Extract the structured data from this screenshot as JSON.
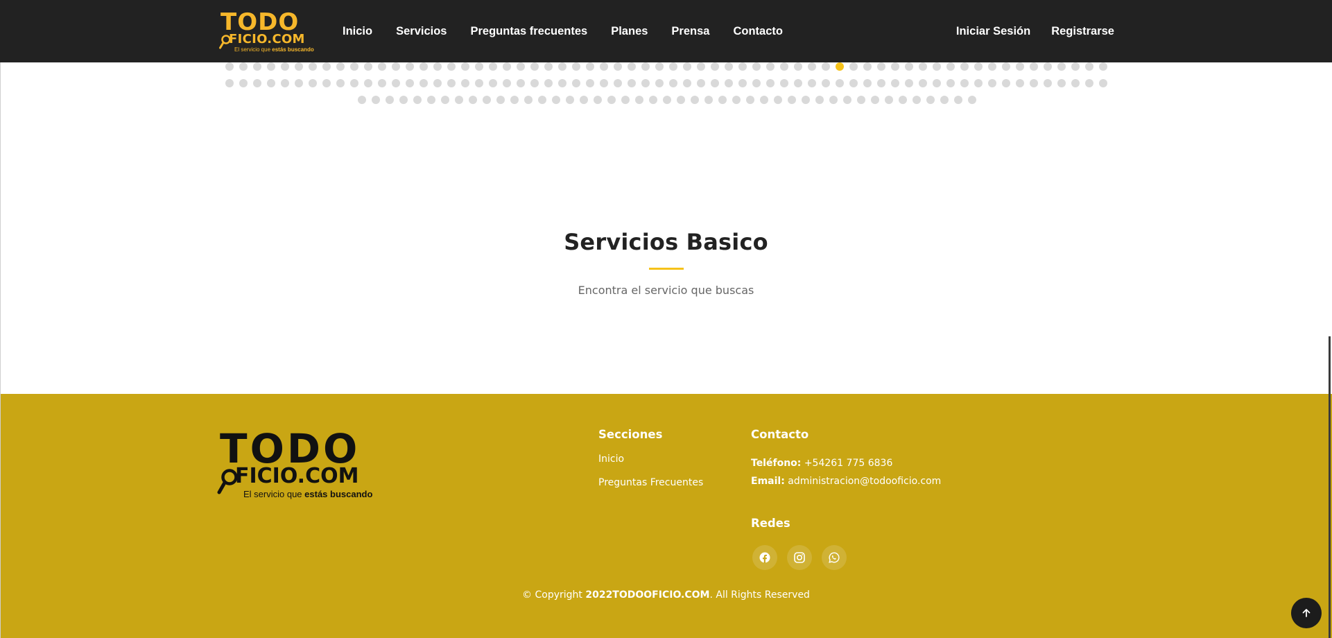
{
  "header": {
    "logo": {
      "top": "TODO",
      "bottom": "FICIO.COM",
      "tagline_pre": "El servicio que ",
      "tagline_bold": "estás buscando"
    },
    "nav": [
      "Inicio",
      "Servicios",
      "Preguntas frecuentes",
      "Planes",
      "Prensa",
      "Contacto"
    ],
    "login": "Iniciar Sesión",
    "register": "Registrarse"
  },
  "carousel": {
    "rows": [
      64,
      64,
      45
    ],
    "active_row": 1,
    "active_index": 44,
    "dot_color": "#d9d9d9",
    "active_color": "#f6c21a"
  },
  "section": {
    "title": "Servicios Basico",
    "subtitle": "Encontra el servicio que buscas"
  },
  "footer": {
    "logo": {
      "top": "TODO",
      "bottom": "FICIO.COM",
      "tagline_pre": "El servicio que ",
      "tagline_bold": "estás buscando"
    },
    "sections_heading": "Secciones",
    "sections_links": [
      "Inicio",
      "Preguntas Frecuentes"
    ],
    "contact_heading": "Contacto",
    "phone_label": "Teléfono:",
    "phone_value": "+54261 775 6836",
    "email_label": "Email:",
    "email_value": "administracion@todooficio.com",
    "social_heading": "Redes",
    "social_icons": [
      "facebook-icon",
      "instagram-icon",
      "whatsapp-icon"
    ],
    "copyright_pre": "© Copyright ",
    "copyright_brand": "2022TODOOFICIO.COM",
    "copyright_post": ". All Rights Reserved",
    "background": "#c9a614"
  },
  "colors": {
    "header_bg": "#222222",
    "accent": "#f6c21a",
    "logo_yellow": "#f6b72b"
  }
}
